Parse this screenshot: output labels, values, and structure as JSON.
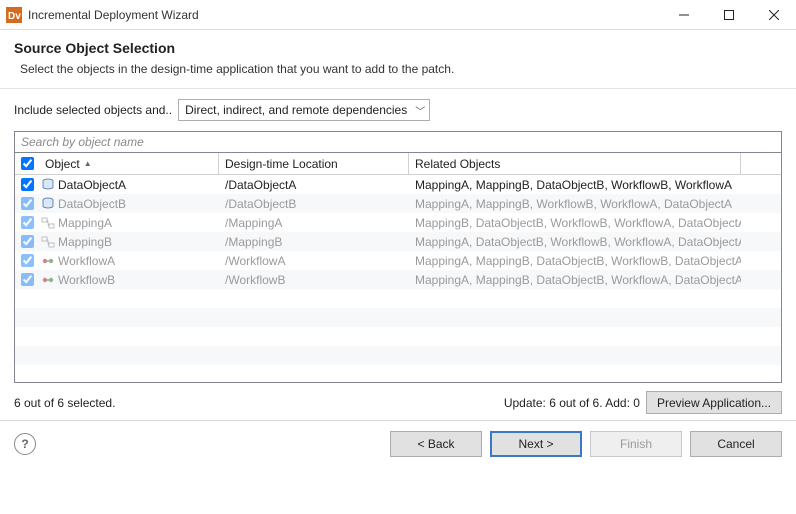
{
  "window": {
    "title": "Incremental Deployment Wizard"
  },
  "header": {
    "title": "Source Object Selection",
    "subtitle": "Select the objects in the design-time application that you want to add to the patch."
  },
  "dependency": {
    "label": "Include selected objects and..",
    "selected": "Direct, indirect, and remote dependencies"
  },
  "search": {
    "placeholder": "Search by object name"
  },
  "table": {
    "columns": {
      "object": "Object",
      "location": "Design-time Location",
      "related": "Related Objects"
    },
    "rows": [
      {
        "checked": true,
        "active": true,
        "icon": "data",
        "name": "DataObjectA",
        "location": "/DataObjectA",
        "related": "MappingA, MappingB, DataObjectB, WorkflowB, WorkflowA"
      },
      {
        "checked": true,
        "active": false,
        "icon": "data",
        "name": "DataObjectB",
        "location": "/DataObjectB",
        "related": "MappingA, MappingB, WorkflowB, WorkflowA, DataObjectA"
      },
      {
        "checked": true,
        "active": false,
        "icon": "mapping",
        "name": "MappingA",
        "location": "/MappingA",
        "related": "MappingB, DataObjectB, WorkflowB, WorkflowA, DataObjectA"
      },
      {
        "checked": true,
        "active": false,
        "icon": "mapping",
        "name": "MappingB",
        "location": "/MappingB",
        "related": "MappingA, DataObjectB, WorkflowB, WorkflowA, DataObjectA"
      },
      {
        "checked": true,
        "active": false,
        "icon": "workflow",
        "name": "WorkflowA",
        "location": "/WorkflowA",
        "related": "MappingA, MappingB, DataObjectB, WorkflowB, DataObjectA"
      },
      {
        "checked": true,
        "active": false,
        "icon": "workflow",
        "name": "WorkflowB",
        "location": "/WorkflowB",
        "related": "MappingA, MappingB, DataObjectB, WorkflowA, DataObjectA"
      }
    ]
  },
  "status": {
    "selected": "6 out of 6 selected.",
    "update_add": "Update: 6 out of 6.  Add: 0",
    "preview": "Preview Application..."
  },
  "footer": {
    "back": "< Back",
    "next": "Next >",
    "finish": "Finish",
    "cancel": "Cancel"
  }
}
